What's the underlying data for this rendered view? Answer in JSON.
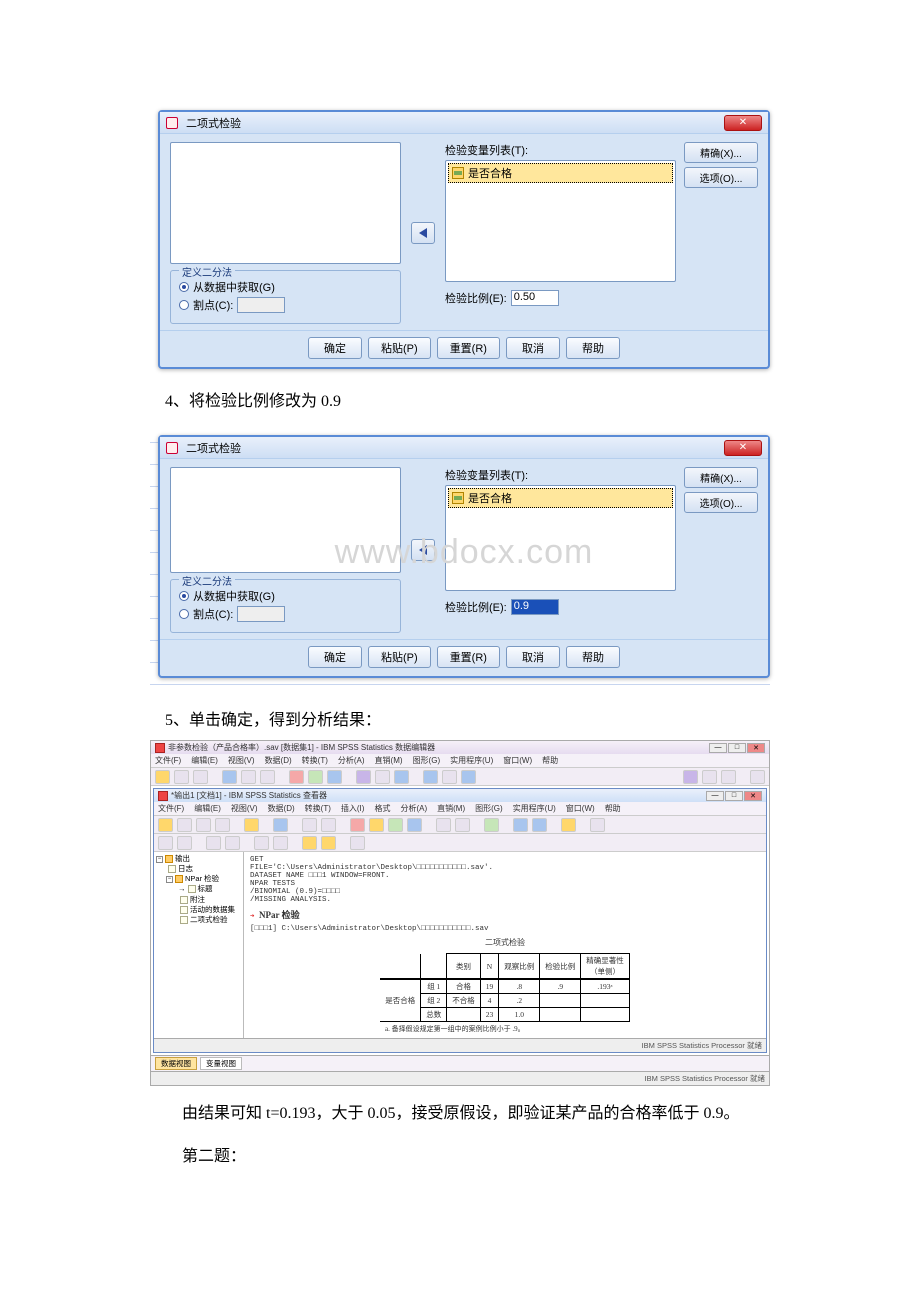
{
  "dialog": {
    "title": "二项式检验",
    "close_x": "✕",
    "var_list_label": "检验变量列表(T):",
    "var_item": "是否合格",
    "exact_btn": "精确(X)...",
    "options_btn": "选项(O)...",
    "group_legend": "定义二分法",
    "radio_fromdata": "从数据中获取(G)",
    "radio_cutpoint": "割点(C):",
    "ratio_label": "检验比例(E):",
    "ratio_val_1": "0.50",
    "ratio_val_2": "0.9",
    "ok": "确定",
    "paste": "粘贴(P)",
    "reset": "重置(R)",
    "cancel": "取消",
    "help": "帮助"
  },
  "steps": {
    "s4": "4、将检验比例修改为 0.9",
    "s5": "5、单击确定，得到分析结果：",
    "watermark": "www.bdocx.com"
  },
  "viewer": {
    "outer_title": "非参数检验（产品合格率）.sav [数据集1] - IBM SPSS Statistics 数据编辑器",
    "inner_title": "*输出1 [文档1] - IBM SPSS Statistics 查看器",
    "menus_outer": [
      "文件(F)",
      "编辑(E)",
      "视图(V)",
      "数据(D)",
      "转换(T)",
      "分析(A)",
      "直销(M)",
      "图形(G)",
      "实用程序(U)",
      "窗口(W)",
      "帮助"
    ],
    "menus_inner": [
      "文件(F)",
      "编辑(E)",
      "视图(V)",
      "数据(D)",
      "转换(T)",
      "插入(I)",
      "格式",
      "分析(A)",
      "直销(M)",
      "图形(G)",
      "实用程序(U)",
      "窗口(W)",
      "帮助"
    ],
    "tree": {
      "root": "输出",
      "n1": "日志",
      "n2": "NPar 检验",
      "n3": "标题",
      "n4": "附注",
      "n5": "活动的数据集",
      "n6": "二项式检验"
    },
    "syntax": {
      "l1": "GET",
      "l2": "  FILE='C:\\Users\\Administrator\\Desktop\\□□□□□□□□□□□.sav'.",
      "l3": "DATASET NAME □□□1 WINDOW=FRONT.",
      "l4": "NPAR TESTS",
      "l5": "  /BINOMIAL (0.9)=□□□□",
      "l6": "  /MISSING ANALYSIS.",
      "head": "NPar 检验",
      "ds": "[□□□1] C:\\Users\\Administrator\\Desktop\\□□□□□□□□□□□.sav"
    },
    "table": {
      "title": "二项式检验",
      "h_cat": "类别",
      "h_n": "N",
      "h_obs": "观察比例",
      "h_test": "检验比例",
      "h_sig": "精确显著性\n（单侧）",
      "rowvar": "是否合格",
      "g1": "组 1",
      "g1_cat": "合格",
      "g1_n": "19",
      "g1_obs": ".8",
      "g1_test": ".9",
      "g1_sig": ".193ᵃ",
      "g2": "组 2",
      "g2_cat": "不合格",
      "g2_n": "4",
      "g2_obs": ".2",
      "g3": "总数",
      "g3_n": "23",
      "g3_obs": "1.0",
      "foot": "a. 备择假设规定第一组中的案例比例小于 .9。"
    },
    "status": "IBM SPSS Statistics Processor 就绪",
    "tab_data": "数据视图",
    "tab_var": "变量视图"
  },
  "conclusion": {
    "p1": "由结果可知 t=0.193，大于 0.05，接受原假设，即验证某产品的合格率低于 0.9。",
    "p2": "第二题："
  }
}
